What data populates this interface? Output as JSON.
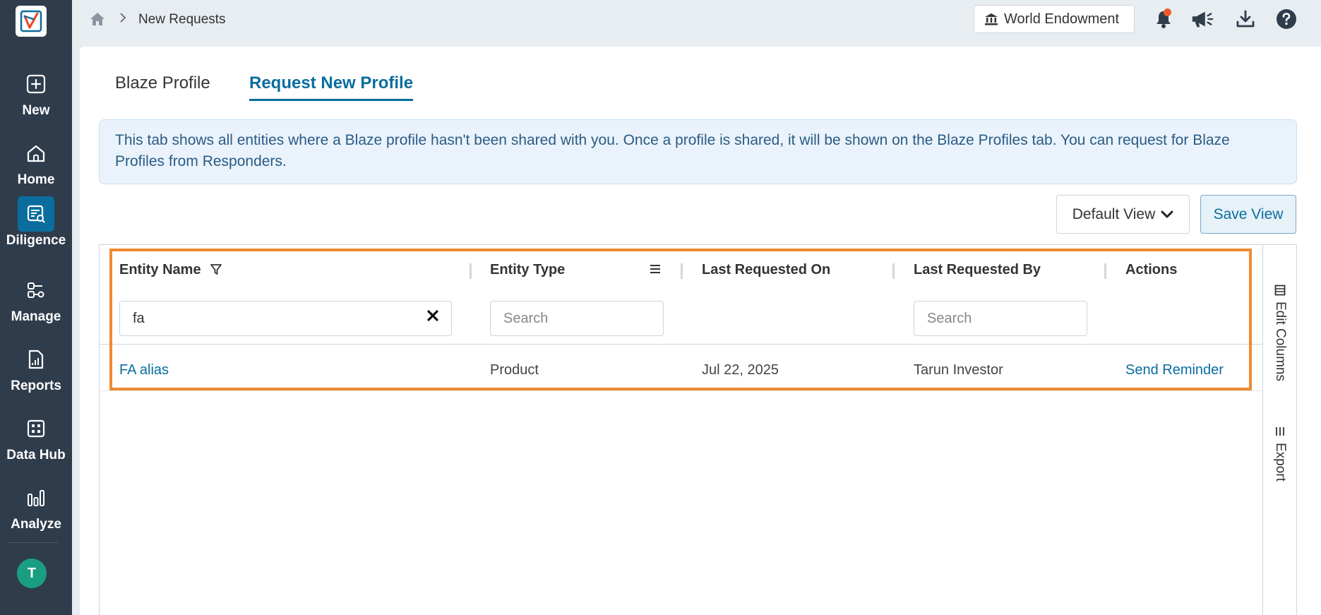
{
  "sidebar": {
    "items": [
      {
        "label": "New",
        "icon": "plus-square-icon"
      },
      {
        "label": "Home",
        "icon": "home-icon"
      },
      {
        "label": "Diligence",
        "icon": "diligence-icon",
        "active": true
      },
      {
        "label": "Manage",
        "icon": "manage-icon"
      },
      {
        "label": "Reports",
        "icon": "reports-icon"
      },
      {
        "label": "Data Hub",
        "icon": "data-hub-icon"
      },
      {
        "label": "Analyze",
        "icon": "analyze-icon"
      }
    ],
    "avatar_initial": "T"
  },
  "topbar": {
    "breadcrumb_current": "New Requests",
    "org_name": "World Endowment"
  },
  "tabs": [
    {
      "label": "Blaze Profile",
      "active": false
    },
    {
      "label": "Request New Profile",
      "active": true
    }
  ],
  "info_text": "This tab shows all entities where a Blaze profile hasn't been shared with you. Once a profile is shared, it will be shown on the Blaze Profiles tab. You can request for Blaze Profiles from Responders.",
  "toolbar": {
    "default_view_label": "Default View",
    "save_view_label": "Save View"
  },
  "grid": {
    "columns": [
      {
        "label": "Entity Name"
      },
      {
        "label": "Entity Type"
      },
      {
        "label": "Last Requested On"
      },
      {
        "label": "Last Requested By"
      },
      {
        "label": "Actions"
      }
    ],
    "filters": {
      "entity_name_value": "fa",
      "entity_type_placeholder": "Search",
      "requested_by_placeholder": "Search"
    },
    "rows": [
      {
        "entity_name": "FA alias",
        "entity_type": "Product",
        "last_requested_on": "Jul 22, 2025",
        "last_requested_by": "Tarun Investor",
        "action": "Send Reminder"
      }
    ],
    "side_panel": {
      "edit_columns_label": "Edit Columns",
      "export_label": "Export"
    }
  },
  "colors": {
    "sidebar_bg": "#2f3c4c",
    "accent": "#0a6d9e",
    "highlight": "#f08a30",
    "notification_dot": "#f05a28"
  }
}
